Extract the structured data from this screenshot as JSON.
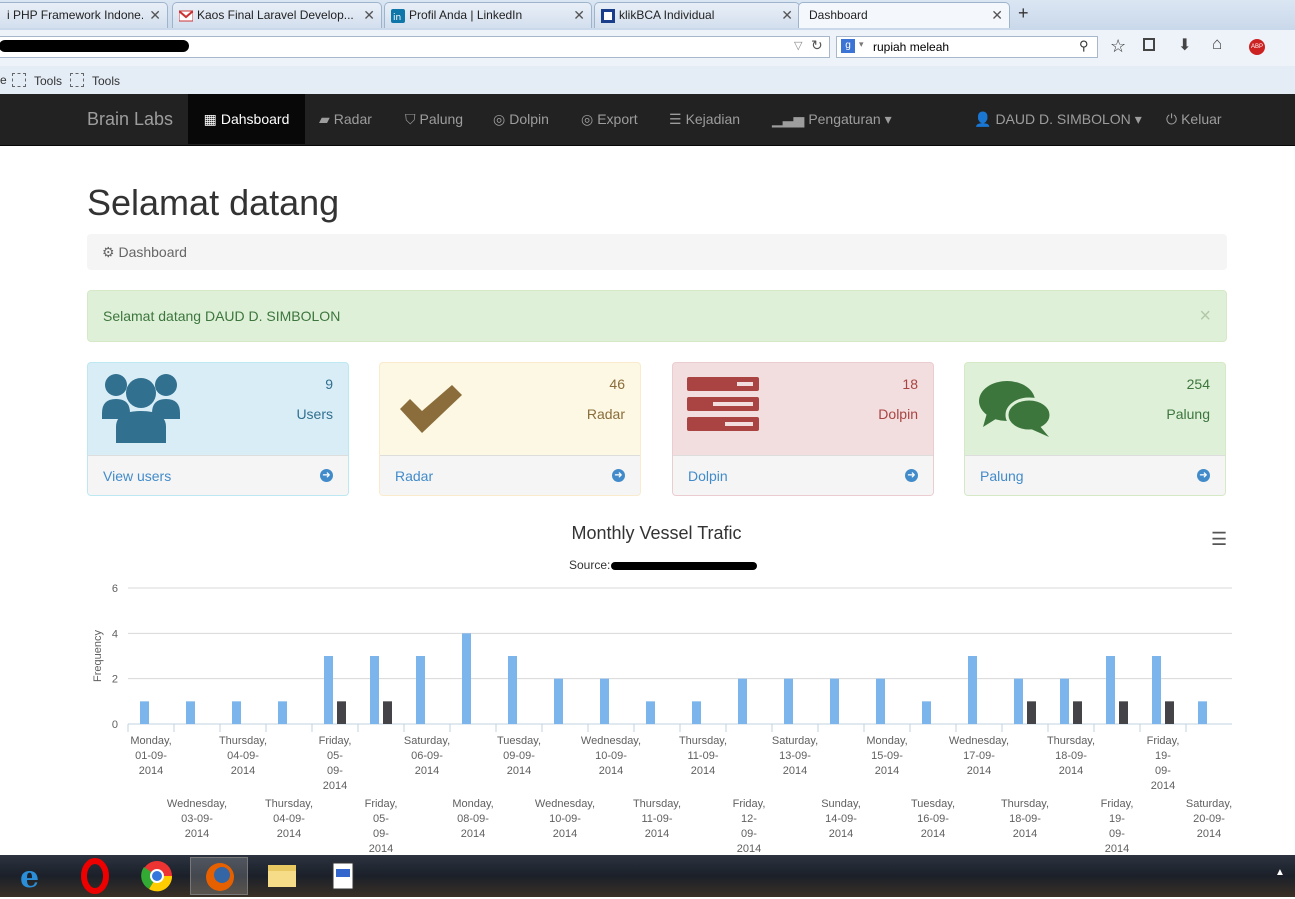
{
  "browser": {
    "tabs": [
      {
        "title": "i PHP Framework Indone...",
        "icon": "page-icon"
      },
      {
        "title": "Kaos Final Laravel Develop...",
        "icon": "gmail-icon"
      },
      {
        "title": "Profil Anda | LinkedIn",
        "icon": "linkedin-icon"
      },
      {
        "title": "klikBCA Individual",
        "icon": "bca-icon"
      },
      {
        "title": "Dashboard",
        "icon": "",
        "active": true
      }
    ],
    "new_tab": "+",
    "search_value": "rupiah meleah",
    "bookmarks": [
      "e",
      "Tools",
      "Tools"
    ]
  },
  "app": {
    "brand": "Brain Labs",
    "nav": [
      {
        "label": "Dahsboard",
        "icon": "windows-icon",
        "active": true
      },
      {
        "label": "Radar",
        "icon": "book-icon"
      },
      {
        "label": "Palung",
        "icon": "shield-icon"
      },
      {
        "label": "Dolpin",
        "icon": "lifebuoy-icon"
      },
      {
        "label": "Export",
        "icon": "lifebuoy-icon"
      },
      {
        "label": "Kejadian",
        "icon": "list-icon"
      },
      {
        "label": "Pengaturan",
        "icon": "signal-icon",
        "dropdown": true
      }
    ],
    "user": "DAUD D. SIMBOLON",
    "logout": "Keluar"
  },
  "page": {
    "title": "Selamat datang",
    "breadcrumb": "Dashboard",
    "alert": "Selamat datang DAUD D. SIMBOLON",
    "alert_close": "×"
  },
  "panels": [
    {
      "count": "9",
      "label": "Users",
      "link": "View users",
      "color": "#31708f",
      "bg": "#d9edf7",
      "border": "#bce8f1",
      "icon": "users-icon"
    },
    {
      "count": "46",
      "label": "Radar",
      "link": "Radar",
      "color": "#8a6d3b",
      "bg": "#fcf8e3",
      "border": "#faebcc",
      "icon": "check-icon"
    },
    {
      "count": "18",
      "label": "Dolpin",
      "link": "Dolpin",
      "color": "#a94442",
      "bg": "#f2dede",
      "border": "#ebccd1",
      "icon": "tasks-icon"
    },
    {
      "count": "254",
      "label": "Palung",
      "link": "Palung",
      "color": "#3c763d",
      "bg": "#dff0d8",
      "border": "#d6e9c6",
      "icon": "comments-icon"
    }
  ],
  "chart_data": {
    "type": "bar",
    "title": "Monthly Vessel Trafic",
    "subtitle": "Source:",
    "xlabel": "",
    "ylabel": "Frequency",
    "ylim": [
      0,
      6
    ],
    "yticks": [
      0,
      2,
      4,
      6
    ],
    "grid": true,
    "legend": "none",
    "colors": [
      "#7cb5ec",
      "#434348"
    ],
    "categories": [
      "Monday, 01-09-2014",
      "Wednesday, 03-09-2014",
      "Thursday, 04-09-2014",
      "Thursday, 04-09-2014",
      "Friday, 05-09-2014",
      "Friday, 05-09-2014",
      "Saturday, 06-09-2014",
      "Monday, 08-09-2014",
      "Tuesday, 09-09-2014",
      "Wednesday, 10-09-2014",
      "Wednesday, 10-09-2014",
      "Thursday, 11-09-2014",
      "Thursday, 11-09-2014",
      "Friday, 12-09-2014",
      "Saturday, 13-09-2014",
      "Sunday, 14-09-2014",
      "Monday, 15-09-2014",
      "Tuesday, 16-09-2014",
      "Wednesday, 17-09-2014",
      "Thursday, 18-09-2014",
      "Thursday, 18-09-2014",
      "Friday, 19-09-2014",
      "Friday, 19-09-2014",
      "Saturday, 20-09-2014"
    ],
    "series": [
      {
        "values": [
          1,
          1,
          1,
          1,
          3,
          3,
          3,
          4,
          3,
          2,
          2,
          1,
          1,
          2,
          2,
          2,
          2,
          1,
          3,
          2,
          2,
          3,
          3,
          1
        ]
      },
      {
        "values": [
          0,
          0,
          0,
          0,
          1,
          1,
          0,
          0,
          0,
          0,
          0,
          0,
          0,
          0,
          0,
          0,
          0,
          0,
          0,
          1,
          1,
          1,
          1,
          0
        ]
      }
    ]
  }
}
